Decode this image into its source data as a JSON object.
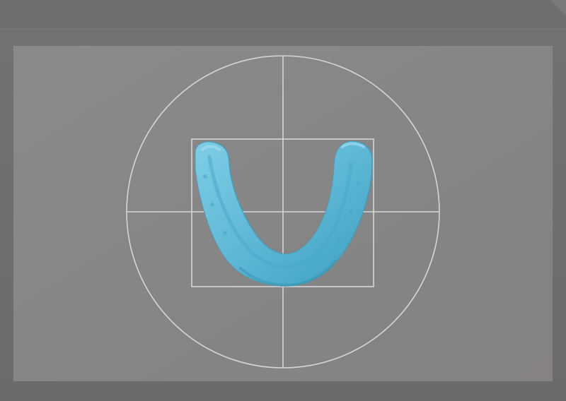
{
  "colors": {
    "box_top": "#6f6f6f",
    "box_side": "#666666",
    "box_front": "#707070",
    "inner_panel": "#868686",
    "guide_lines": "#d8d8dc",
    "model_fill": "#5fbad6",
    "model_shadow": "#3a9dbd",
    "model_highlight": "#8fd4ea"
  },
  "icons": {
    "scan_model": "dental-arch-scan-icon",
    "alignment_guide": "crosshair-circle-icon"
  }
}
